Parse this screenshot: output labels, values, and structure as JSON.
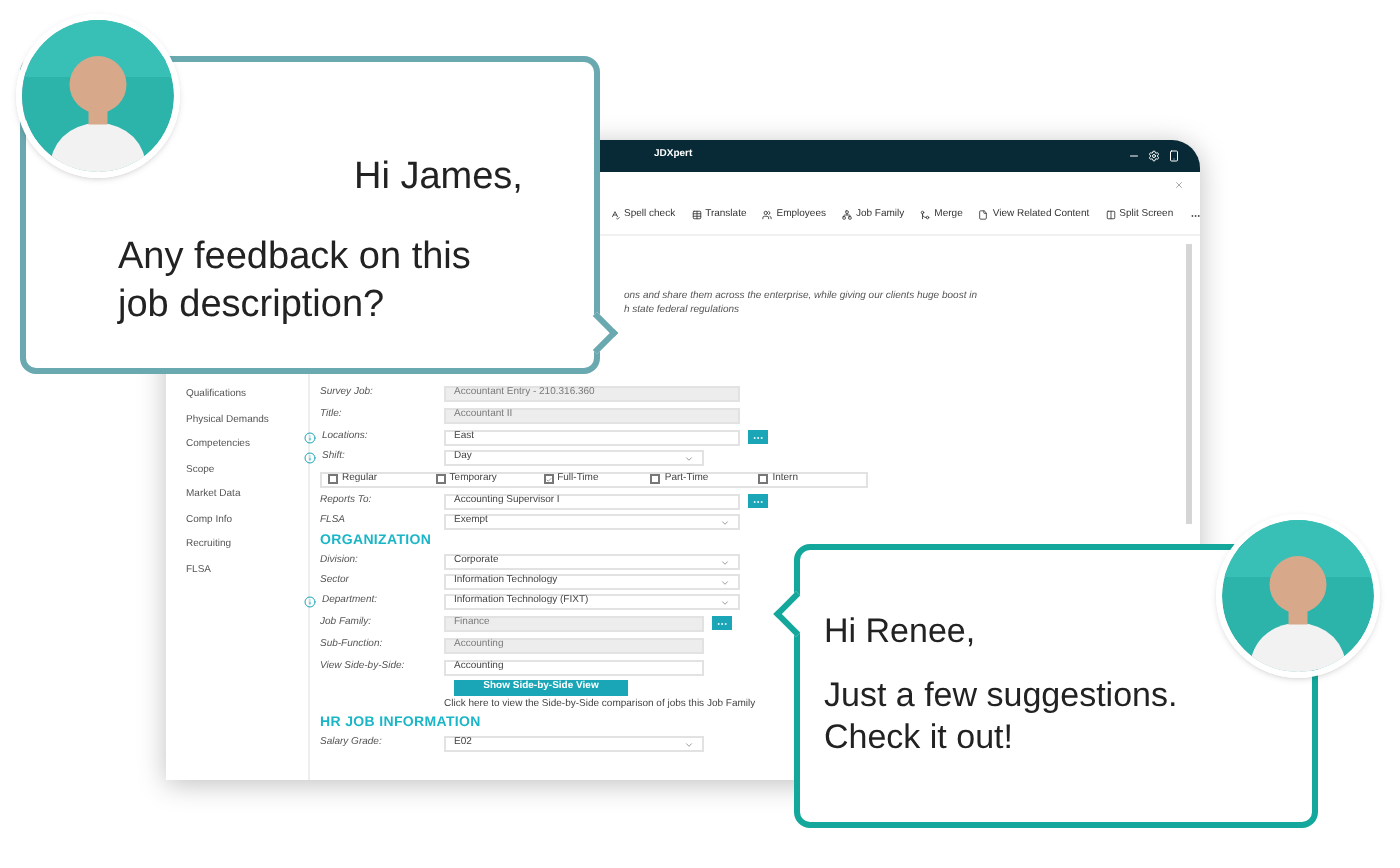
{
  "window": {
    "title": "JDXpert"
  },
  "toolbar": [
    {
      "kind": "spell",
      "label": "Spell check"
    },
    {
      "kind": "translate",
      "label": "Translate"
    },
    {
      "kind": "employees",
      "label": "Employees"
    },
    {
      "kind": "family",
      "label": "Job Family"
    },
    {
      "kind": "merge",
      "label": "Merge"
    },
    {
      "kind": "related",
      "label": "View Related Content"
    },
    {
      "kind": "split",
      "label": "Split Screen"
    }
  ],
  "description": [
    "ons and share them across the enterprise, while giving our clients huge boost in",
    "h state federal regulations"
  ],
  "sidebar": {
    "items": [
      "Qualifications",
      "Physical Demands",
      "Competencies",
      "Scope",
      "Market Data",
      "Comp Info",
      "Recruiting",
      "FLSA"
    ]
  },
  "form": {
    "rows": [
      {
        "kind": "field",
        "label": "Survey Job:",
        "value": "Accountant Entry - 210.316.360",
        "disabled": true
      },
      {
        "kind": "field",
        "label": "Title:",
        "value": "Accountant II",
        "disabled": true
      },
      {
        "kind": "field",
        "label": "Locations:",
        "value": "East",
        "disabled": false,
        "info": true,
        "more": true
      },
      {
        "kind": "select",
        "label": "Shift:",
        "value": "Day",
        "info": true,
        "narrow": true
      },
      {
        "kind": "checkboxes",
        "options": [
          {
            "label": "Regular",
            "checked": false
          },
          {
            "label": "Temporary",
            "checked": false
          },
          {
            "label": "Full-Time",
            "checked": true
          },
          {
            "label": "Part-Time",
            "checked": false
          },
          {
            "label": "Intern",
            "checked": false
          }
        ]
      },
      {
        "kind": "field",
        "label": "Reports To:",
        "value": "Accounting Supervisor I",
        "disabled": false,
        "more": true
      },
      {
        "kind": "select",
        "label": "FLSA",
        "value": "Exempt"
      },
      {
        "kind": "heading",
        "label": "ORGANIZATION"
      },
      {
        "kind": "select",
        "label": "Division:",
        "value": "Corporate"
      },
      {
        "kind": "select",
        "label": "Sector",
        "value": "Information Technology"
      },
      {
        "kind": "select",
        "label": "Department:",
        "value": "Information Technology (FIXT)",
        "info": true
      },
      {
        "kind": "field",
        "label": "Job Family:",
        "value": "Finance",
        "disabled": true,
        "more": true,
        "narrow": true
      },
      {
        "kind": "field",
        "label": "Sub-Function:",
        "value": "Accounting",
        "disabled": true,
        "narrow": true
      },
      {
        "kind": "field",
        "label": "View Side-by-Side:",
        "value": "Accounting",
        "disabled": false,
        "narrow": true
      },
      {
        "kind": "button",
        "label": "Show Side-by-Side View"
      },
      {
        "kind": "note",
        "label": "Click here to view the Side-by-Side comparison of jobs this Job Family"
      },
      {
        "kind": "heading",
        "label": "HR JOB INFORMATION"
      },
      {
        "kind": "select",
        "label": "Salary Grade:",
        "value": "E02",
        "narrow": true
      }
    ]
  },
  "chat": [
    {
      "lines": [
        "Hi James,",
        "Any feedback on this",
        "job description?"
      ]
    },
    {
      "lines": [
        "Hi Renee,",
        "Just a few suggestions.",
        "Check it out!"
      ]
    }
  ]
}
